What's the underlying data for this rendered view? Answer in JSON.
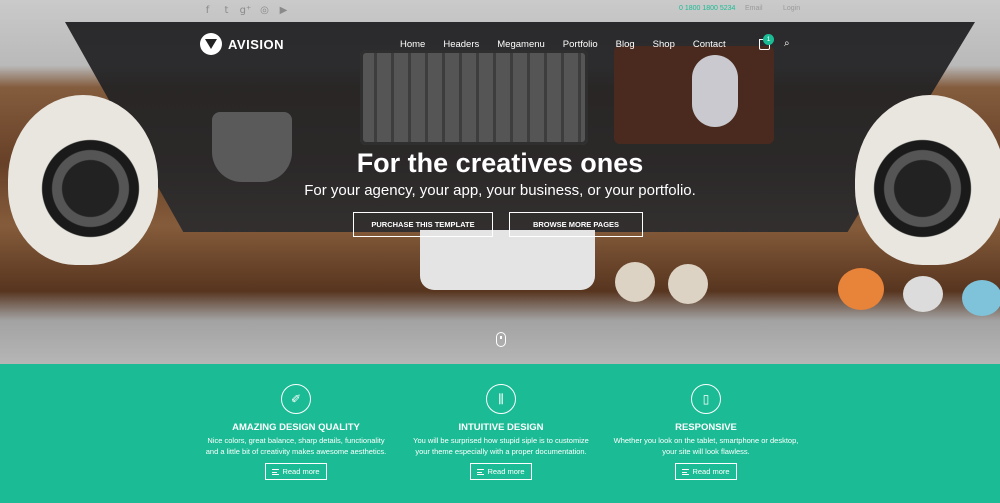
{
  "topbar": {
    "social_icons": [
      "facebook-icon",
      "twitter-icon",
      "google-plus-icon",
      "dribbble-icon",
      "youtube-icon"
    ],
    "phone": "0 1800 1800 5234",
    "email_label": "Email",
    "login_label": "Login"
  },
  "brand": {
    "name": "AVISION"
  },
  "nav": {
    "items": [
      "Home",
      "Headers",
      "Megamenu",
      "Portfolio",
      "Blog",
      "Shop",
      "Contact"
    ],
    "cart_count": "1"
  },
  "hero": {
    "title": "For the creatives ones",
    "subtitle": "For your agency, your app, your business, or your portfolio.",
    "primary_button": "PURCHASE THIS TEMPLATE",
    "secondary_button": "BROWSE MORE PAGES"
  },
  "features": [
    {
      "icon": "magic-wand-icon",
      "title": "AMAZING DESIGN QUALITY",
      "text_line1": "Nice colors, great balance, sharp details, functionality",
      "text_line2": "and a little bit of creativity makes awesome aesthetics.",
      "button": "Read more"
    },
    {
      "icon": "sliders-icon",
      "title": "INTUITIVE DESIGN",
      "text_line1": "You will be surprised how stupid siple is to customize",
      "text_line2": "your theme especially with a proper documentation.",
      "button": "Read more"
    },
    {
      "icon": "smartphone-icon",
      "title": "RESPONSIVE",
      "text_line1": "Whether you look on the tablet, smartphone or desktop,",
      "text_line2": "your site will look flawless.",
      "button": "Read more"
    }
  ],
  "colors": {
    "accent": "#1bbc95",
    "text_light": "#ffffff"
  }
}
